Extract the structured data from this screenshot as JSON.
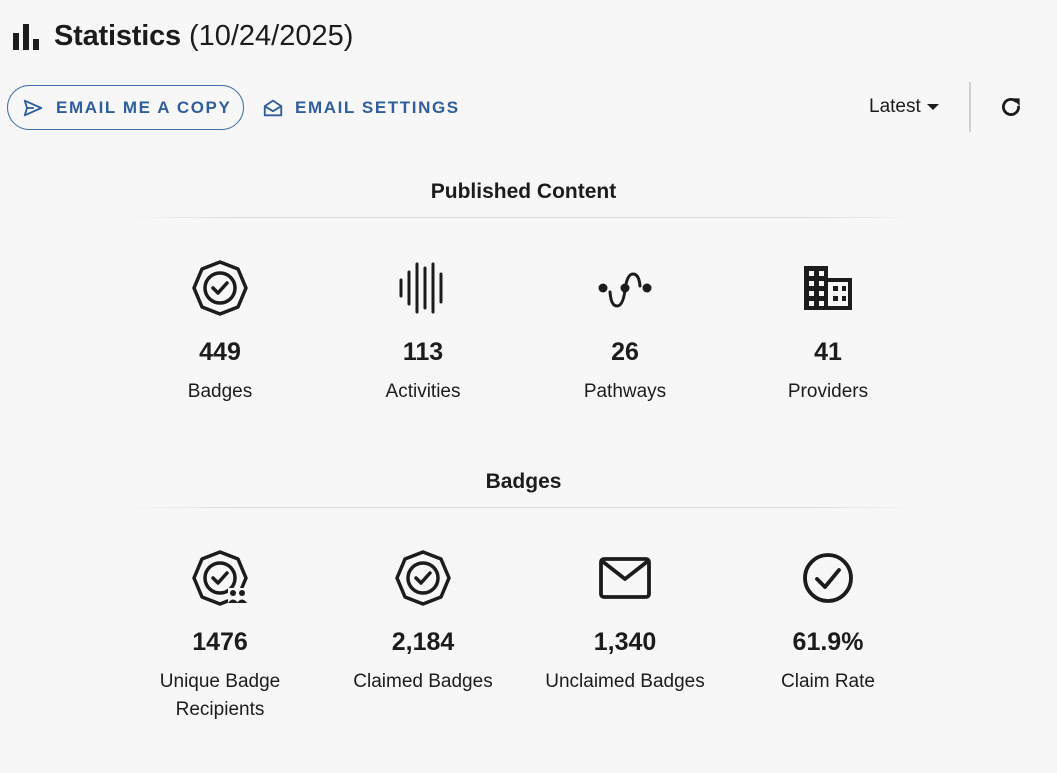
{
  "header": {
    "title": "Statistics",
    "date": "(10/24/2025)",
    "icon": "bar-chart-icon"
  },
  "toolbar": {
    "email_copy_label": "EMAIL ME A COPY",
    "email_settings_label": "EMAIL SETTINGS",
    "range_select_value": "Latest",
    "refresh_icon": "refresh-icon",
    "accent_color": "#2f5e9b"
  },
  "published": {
    "title": "Published Content",
    "stats": [
      {
        "value": "449",
        "label": "Badges",
        "icon": "badge-check-icon"
      },
      {
        "value": "113",
        "label": "Activities",
        "icon": "activity-bars-icon"
      },
      {
        "value": "26",
        "label": "Pathways",
        "icon": "pathway-icon"
      },
      {
        "value": "41",
        "label": "Providers",
        "icon": "building-icon"
      }
    ]
  },
  "badges": {
    "title": "Badges",
    "stats": [
      {
        "value": "1476",
        "label": "Unique Badge Recipients",
        "icon": "badge-recipients-icon"
      },
      {
        "value": "2,184",
        "label": "Claimed Badges",
        "icon": "badge-check-icon"
      },
      {
        "value": "1,340",
        "label": "Unclaimed Badges",
        "icon": "mail-icon"
      },
      {
        "value": "61.9%",
        "label": "Claim Rate",
        "icon": "check-circle-icon"
      }
    ]
  }
}
